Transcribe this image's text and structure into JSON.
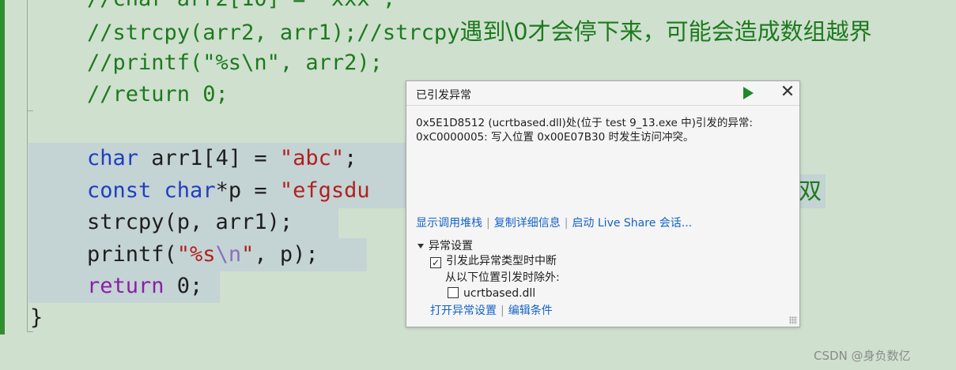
{
  "code_lines": {
    "l0": "//char arr2[10] = \"xxx\";",
    "l1_comment": "//strcpy(arr2, arr1);//strcpy",
    "l1_cjk": "遇到\\0才会停下来，可能会造成数组越界",
    "l2": "//printf(\"%s\\n\", arr2);",
    "l3": "//return 0;",
    "l4_kw": "char",
    "l4_mid": " arr1[4] = ",
    "l4_str": "\"abc\"",
    "l4_end": ";",
    "l5_kw1": "const",
    "l5_kw2": "char",
    "l5_mid": "*p = ",
    "l5_str": "\"efgsdu",
    "l5_tail_fragment": "双",
    "l6": "strcpy(p, arr1);",
    "l7_pre": "printf(",
    "l7_str1": "\"%s",
    "l7_esc": "\\n",
    "l7_str2": "\"",
    "l7_end": ", p);",
    "l8_kw": "return",
    "l8_end": " 0;",
    "l9": "}"
  },
  "dialog": {
    "title": "已引发异常",
    "message_line1": "0x5E1D8512 (ucrtbased.dll)处(位于 test 9_13.exe 中)引发的异常:",
    "message_line2": "0xC0000005: 写入位置 0x00E07B30 时发生访问冲突。",
    "link_call_stack": "显示调用堆栈",
    "link_copy_details": "复制详细信息",
    "link_live_share": "启动 Live Share 会话...",
    "section_title": "异常设置",
    "checkbox_break_label": "引发此异常类型时中断",
    "checkbox_break_checked": true,
    "except_label": "从以下位置引发时除外:",
    "checkbox_dll_label": "ucrtbased.dll",
    "checkbox_dll_checked": false,
    "link_open_settings": "打开异常设置",
    "link_edit_conditions": "编辑条件",
    "continue_icon": "play-icon",
    "close_icon": "close-icon"
  },
  "watermark": "CSDN @身负数亿",
  "colors": {
    "editor_bg": "#cfe0cf",
    "comment": "#1d7a1d",
    "keyword": "#1f3fbf",
    "return_keyword": "#8a1fa6",
    "string": "#b22020",
    "link": "#1463c7"
  }
}
